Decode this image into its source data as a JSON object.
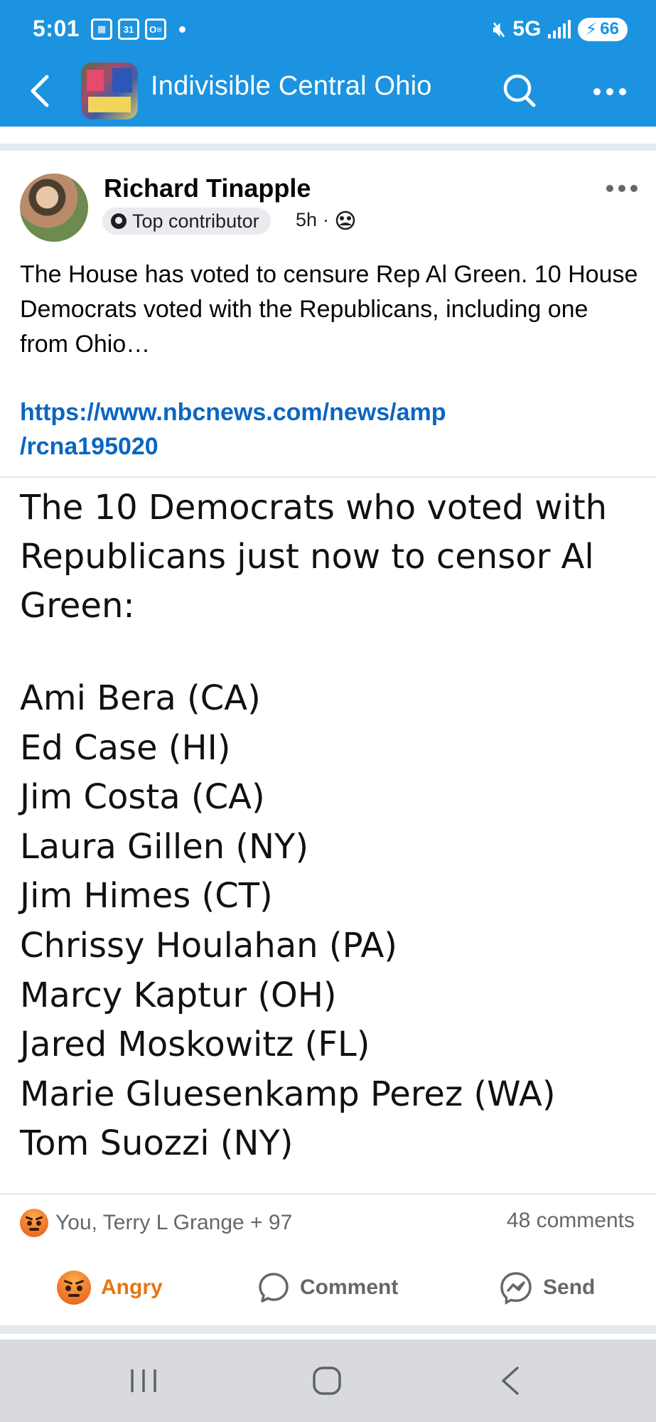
{
  "status_bar": {
    "time": "5:01",
    "network": "5G",
    "battery": "66",
    "calendar_day": "31",
    "icons": [
      "calendar-icon",
      "calendar-31-icon",
      "outlook-icon",
      "notification-dot",
      "mute-icon",
      "signal-icon",
      "battery-icon"
    ]
  },
  "header": {
    "group_name": "Indivisible Central Ohio",
    "icons": [
      "back-arrow-icon",
      "search-icon",
      "more-horizontal-icon"
    ]
  },
  "post": {
    "author": "Richard Tinapple",
    "badge": "Top contributor",
    "time": "5h",
    "time_separator": "·",
    "text": "The House has voted to censure Rep Al Green. 10 House Democrats voted with the Republicans, including one from Ohio…",
    "link_line1": "https://www.nbcnews.com/news/amp",
    "link_line2": "/rcna195020",
    "image_text": {
      "heading": "The 10 Democrats who voted with Republicans just now to censor Al Green:",
      "members": [
        "Ami Bera (CA)",
        "Ed Case (HI)",
        "Jim Costa (CA)",
        "Laura Gillen (NY)",
        "Jim Himes (CT)",
        "Chrissy Houlahan (PA)",
        "Marcy Kaptur (OH)",
        "Jared Moskowitz (FL)",
        "Marie Gluesenkamp Perez (WA)",
        "Tom Suozzi (NY)"
      ]
    },
    "reactions_summary": "You, Terry L Grange + 97",
    "comments_count": "48 comments"
  },
  "actions": {
    "angry_label": "Angry",
    "comment_label": "Comment",
    "send_label": "Send"
  },
  "colors": {
    "header_blue": "#1b93e0",
    "link_blue": "#0a66c2",
    "angry_orange": "#e8740f",
    "muted_gray": "#65676b"
  }
}
